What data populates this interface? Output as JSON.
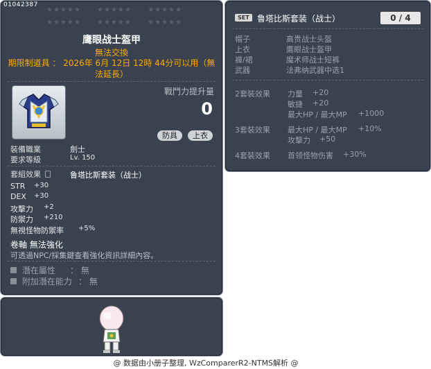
{
  "item": {
    "id": "01042387",
    "stars": [
      "★★★★★",
      "★★★★★",
      "★★★★★",
      "★★★★★",
      "★★★★★",
      "★★★★★"
    ],
    "name": "鹰眼战士盔甲",
    "trade": "無法交換",
    "expiry": "期限制道具 ： 2026年 6月 12日 12時 44分可以用（無法延長）",
    "power_label": "戰鬥力提升量",
    "power_value": "0",
    "tags": [
      "防具",
      "上衣"
    ],
    "job_label": "裝備職業",
    "job_value": "劍士",
    "level_label": "要求等級",
    "level_value": "Lv. 150",
    "set_effect_label": "套組效果",
    "set_effect_name": "鲁塔比斯套装（战士）",
    "stats": [
      {
        "name": "STR",
        "value": "+30"
      },
      {
        "name": "DEX",
        "value": "+30"
      },
      {
        "name": "攻擊力",
        "value": "+2"
      },
      {
        "name": "防禦力",
        "value": "+210"
      },
      {
        "name": "無視怪物防禦率",
        "value": "+5%"
      }
    ],
    "scroll": "卷軸 無法強化",
    "hint": "可透過NPC/採集鍵查看強化資訊詳細內容。",
    "potential_label": "潛在屬性",
    "potential_value": "： 無",
    "add_potential_label": "附加潛在能力",
    "add_potential_value": "： 無"
  },
  "set": {
    "badge": "SET",
    "title": "鲁塔比斯套装（战士）",
    "count": "0 / 4",
    "pieces": [
      {
        "slot": "帽子",
        "name": "高贵战士头盔"
      },
      {
        "slot": "上衣",
        "name": "鷹眼战士盔甲"
      },
      {
        "slot": "褲/裙",
        "name": "魔术师战士短裤"
      },
      {
        "slot": "武器",
        "name": "法弗纳武器中选1"
      }
    ],
    "bonus2_title": "2套裝效果",
    "bonus2": [
      {
        "stat": "力量",
        "value": "+20"
      },
      {
        "stat": "敏捷",
        "value": "+20"
      },
      {
        "stat": "最大HP / 最大MP",
        "value": "+1000"
      }
    ],
    "bonus3_title": "3套裝效果",
    "bonus3": [
      {
        "stat": "最大HP / 最大MP",
        "value": "+10%"
      },
      {
        "stat": "攻擊力",
        "value": "+50"
      }
    ],
    "bonus4_title": "4套裝效果",
    "bonus4": [
      {
        "stat": "首领怪物伤害",
        "value": "+30%"
      }
    ]
  },
  "footer": "@ 数据由小册子整理, WzComparerR2-NTMS解析 @",
  "colors": {
    "panel_bg": "#3a4250",
    "accent_orange": "#ffaa00",
    "title_white": "#ffffff"
  }
}
